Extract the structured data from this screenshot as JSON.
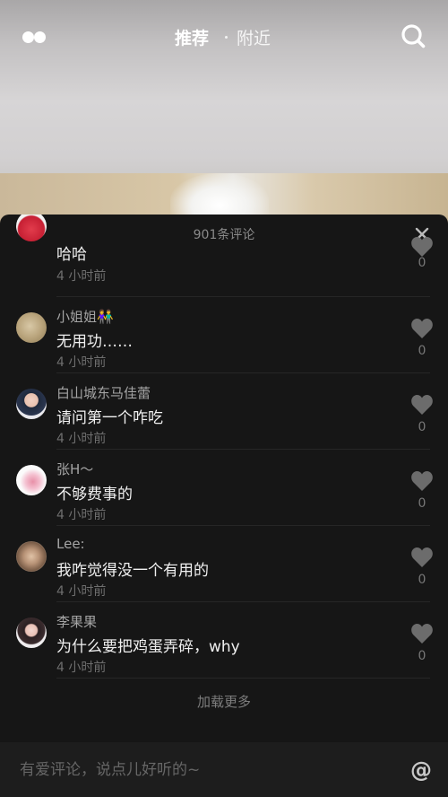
{
  "header": {
    "tabs": [
      {
        "label": "推荐",
        "active": true
      },
      {
        "label": "附近",
        "active": false
      }
    ],
    "icons": [
      "menu-dots-icon",
      "search-icon"
    ]
  },
  "comments_panel": {
    "title": "901条评论",
    "close_icon": "close-icon",
    "comments": [
      {
        "username": "",
        "text": "哈哈",
        "time": "4 小时前",
        "likes": "0"
      },
      {
        "username": "小姐姐👫",
        "text": "无用功……",
        "time": "4 小时前",
        "likes": "0"
      },
      {
        "username": "白山城东马佳蕾",
        "text": "请问第一个咋吃",
        "time": "4 小时前",
        "likes": "0"
      },
      {
        "username": "张H～",
        "text": "不够费事的",
        "time": "4 小时前",
        "likes": "0"
      },
      {
        "username": "Lee:",
        "text": "我咋觉得没一个有用的",
        "time": "4 小时前",
        "likes": "0"
      },
      {
        "username": "李果果",
        "text": "为什么要把鸡蛋弄碎，why",
        "time": "4 小时前",
        "likes": "0"
      }
    ],
    "load_more": "加载更多"
  },
  "comment_input": {
    "placeholder": "有爱评论，说点儿好听的~",
    "value": "",
    "mention_label": "@"
  },
  "colors": {
    "panel_bg": "#161616",
    "text_primary": "#f0f0f0",
    "text_secondary": "#a4a4a4",
    "text_muted": "#6e6e6e"
  }
}
